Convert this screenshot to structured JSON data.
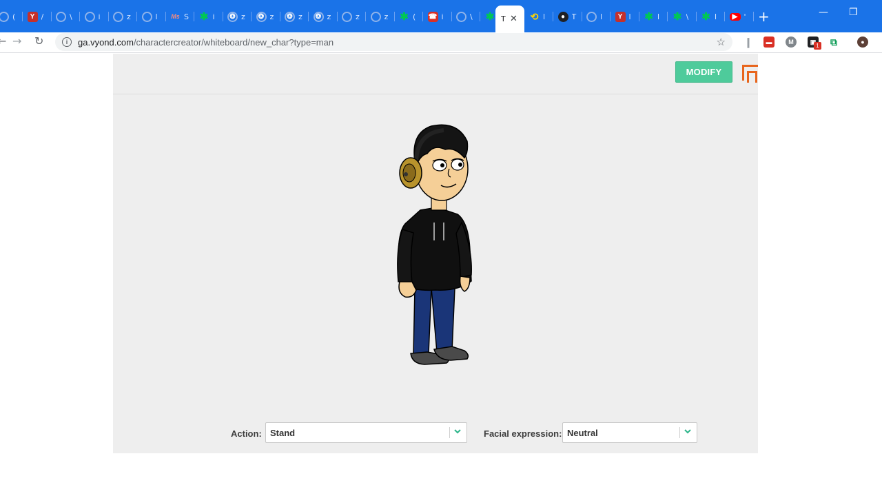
{
  "browser": {
    "tabs": [
      {
        "icon": "ring-icon",
        "glyph": "",
        "cls": "ring",
        "text": "("
      },
      {
        "icon": "y-icon",
        "glyph": "Y",
        "cls": "y",
        "text": "/"
      },
      {
        "icon": "ring-icon",
        "glyph": "",
        "cls": "ring",
        "text": "\\"
      },
      {
        "icon": "ring-icon",
        "glyph": "",
        "cls": "ring",
        "text": "i"
      },
      {
        "icon": "ring-icon",
        "glyph": "",
        "cls": "ring",
        "text": "z"
      },
      {
        "icon": "ring-icon",
        "glyph": "",
        "cls": "ring",
        "text": "l"
      },
      {
        "icon": "ms-icon",
        "glyph": "Ms",
        "cls": "ms",
        "text": "S"
      },
      {
        "icon": "vyond-icon",
        "glyph": "✱",
        "cls": "green",
        "text": "i"
      },
      {
        "icon": "snail-icon",
        "glyph": "❂",
        "cls": "ring",
        "text": "z"
      },
      {
        "icon": "snail-icon",
        "glyph": "❂",
        "cls": "ring",
        "text": "z"
      },
      {
        "icon": "snail-icon",
        "glyph": "❂",
        "cls": "ring",
        "text": "z"
      },
      {
        "icon": "snail-icon",
        "glyph": "❂",
        "cls": "ring",
        "text": "z"
      },
      {
        "icon": "ring-icon",
        "glyph": "",
        "cls": "ring",
        "text": "z"
      },
      {
        "icon": "ring-icon",
        "glyph": "",
        "cls": "ring",
        "text": "z"
      },
      {
        "icon": "vyond-icon",
        "glyph": "✱",
        "cls": "green",
        "text": "("
      },
      {
        "icon": "red-app-icon",
        "glyph": "☎",
        "cls": "red",
        "text": "i"
      },
      {
        "icon": "ring-icon",
        "glyph": "",
        "cls": "ring",
        "text": "\\"
      },
      {
        "icon": "vyond-icon",
        "glyph": "✱",
        "cls": "green",
        "text": "l"
      }
    ],
    "active_tab": {
      "text": "T",
      "close": "✕"
    },
    "tabs_after": [
      {
        "icon": "loop-icon",
        "glyph": "⟲",
        "cls": "loop",
        "text": "l"
      },
      {
        "icon": "github-icon",
        "glyph": "●",
        "cls": "gh",
        "text": "T"
      },
      {
        "icon": "ring-icon",
        "glyph": "",
        "cls": "ring",
        "text": "l"
      },
      {
        "icon": "y-icon",
        "glyph": "Y",
        "cls": "y",
        "text": "l"
      },
      {
        "icon": "vyond-icon",
        "glyph": "✱",
        "cls": "green",
        "text": "l"
      },
      {
        "icon": "vyond-icon",
        "glyph": "✱",
        "cls": "green",
        "text": "\\"
      },
      {
        "icon": "vyond-icon",
        "glyph": "✱",
        "cls": "green",
        "text": "l"
      },
      {
        "icon": "youtube-icon",
        "glyph": "▶",
        "cls": "yt",
        "text": "'"
      }
    ],
    "new_tab": "+",
    "url_host": "ga.vyond.com",
    "url_path": "/charactercreator/whiteboard/new_char?type=man",
    "ext_badge": "1"
  },
  "app": {
    "modify_label": "MODIFY",
    "action_label": "Action:",
    "action_value": "Stand",
    "expression_label": "Facial expression:",
    "expression_value": "Neutral"
  },
  "colors": {
    "accent": "#4ecb9b",
    "save": "#e8651c",
    "chrome_blue": "#1a73e8"
  }
}
